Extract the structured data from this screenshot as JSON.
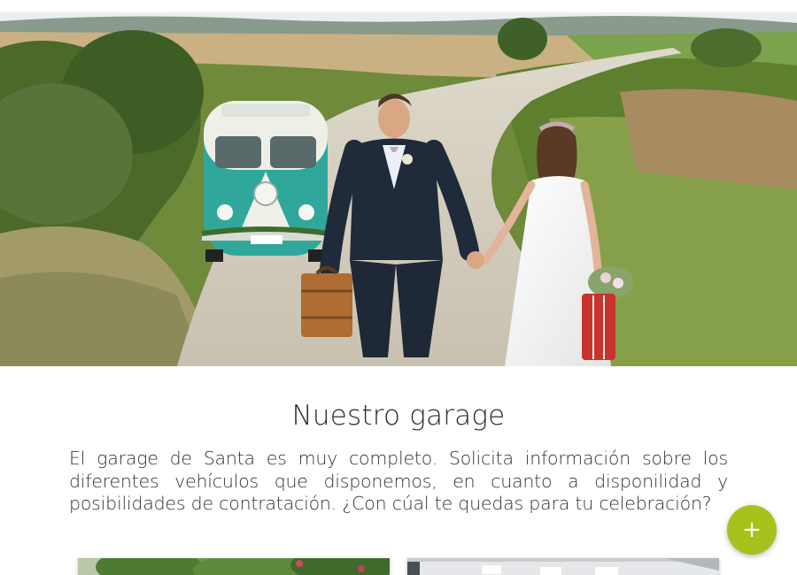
{
  "hero": {
    "image_description_icon": "wedding-couple-photo"
  },
  "garage": {
    "title": "Nuestro garage",
    "description": "El garage de Santa es muy completo. Solicita información sobre los diferentes vehículos que disponemos, en cuanto a disponilidad y posibilidades de contratación. ¿Con cúal te quedas para tu celebración?"
  },
  "fab": {
    "icon": "plus-icon",
    "symbol": "+"
  },
  "colors": {
    "fab": "#a9c11d",
    "van_turquoise": "#2fa89b",
    "suitcase_red": "#c8332d"
  }
}
